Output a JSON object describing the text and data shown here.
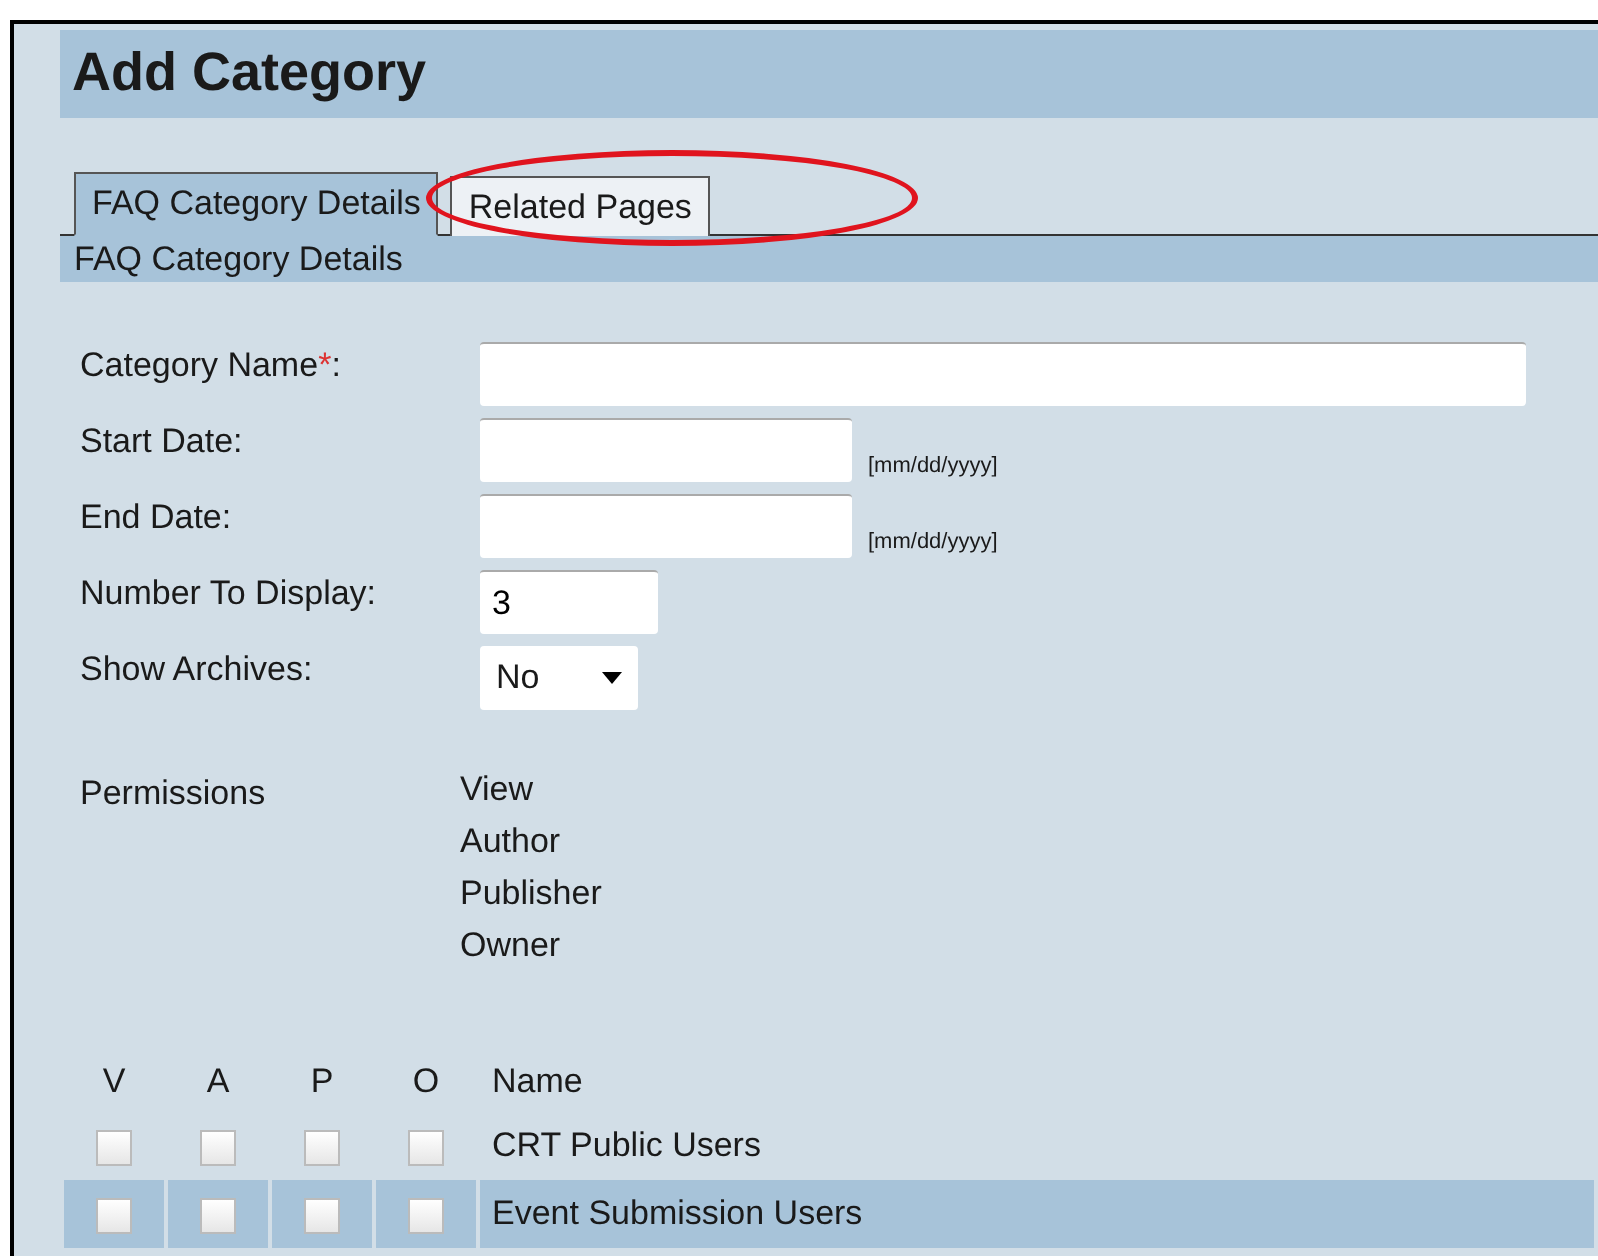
{
  "page": {
    "title": "Add Category"
  },
  "tabs": [
    {
      "label": "FAQ Category Details",
      "selected": true
    },
    {
      "label": "Related Pages",
      "selected": false,
      "circled": true
    }
  ],
  "section": {
    "title": "FAQ Category Details"
  },
  "fields": [
    {
      "kind": "text",
      "label": "Category Name",
      "required_mark": "*",
      "label_end": ":"
    },
    {
      "kind": "text",
      "label": "Start Date:",
      "hint": "[mm/dd/yyyy]"
    },
    {
      "kind": "text",
      "label": "End Date:",
      "hint": "[mm/dd/yyyy]"
    },
    {
      "kind": "text",
      "label": "Number To Display:",
      "value": "3"
    },
    {
      "kind": "select",
      "label": "Show Archives:",
      "value": "No"
    }
  ],
  "permissions": {
    "label": "Permissions",
    "levels": [
      "View",
      "Author",
      "Publisher",
      "Owner"
    ]
  },
  "table": {
    "columns": [
      "V",
      "A",
      "P",
      "O",
      "Name"
    ],
    "rows": [
      {
        "name": "CRT Public Users",
        "selected": false,
        "checks": [
          false,
          false,
          false,
          false
        ]
      },
      {
        "name": "Event Submission Users",
        "selected": true,
        "checks": [
          false,
          false,
          false,
          false
        ]
      }
    ]
  }
}
